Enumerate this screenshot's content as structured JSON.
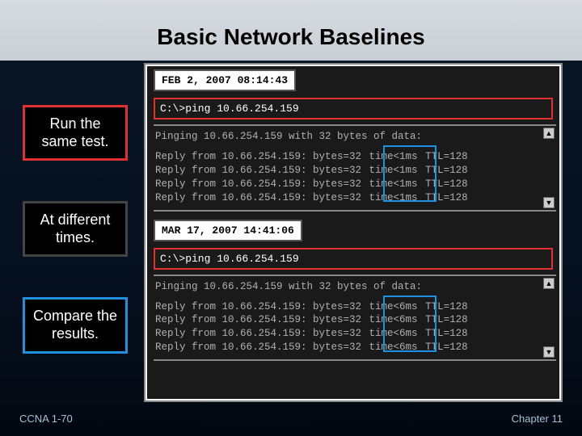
{
  "title": "Basic Network Baselines",
  "labels": {
    "run": "Run the same test.",
    "different": "At different times.",
    "compare": "Compare the results."
  },
  "run1": {
    "timestamp": "FEB 2, 2007  08:14:43",
    "command": "C:\\>ping 10.66.254.159",
    "ping_header": "Pinging 10.66.254.159 with 32 bytes of data:",
    "reply_prefix": "Reply from 10.66.254.159: bytes=32 ",
    "time": "time<1ms",
    "ttl": " TTL=128"
  },
  "run2": {
    "timestamp": "MAR 17, 2007  14:41:06",
    "command": "C:\\>ping 10.66.254.159",
    "ping_header": "Pinging 10.66.254.159 with 32 bytes of data:",
    "reply_prefix": "Reply from 10.66.254.159: bytes=32 ",
    "time": "time<6ms",
    "ttl": " TTL=128"
  },
  "footer": {
    "left": "CCNA 1-70",
    "right": "Chapter 11"
  }
}
